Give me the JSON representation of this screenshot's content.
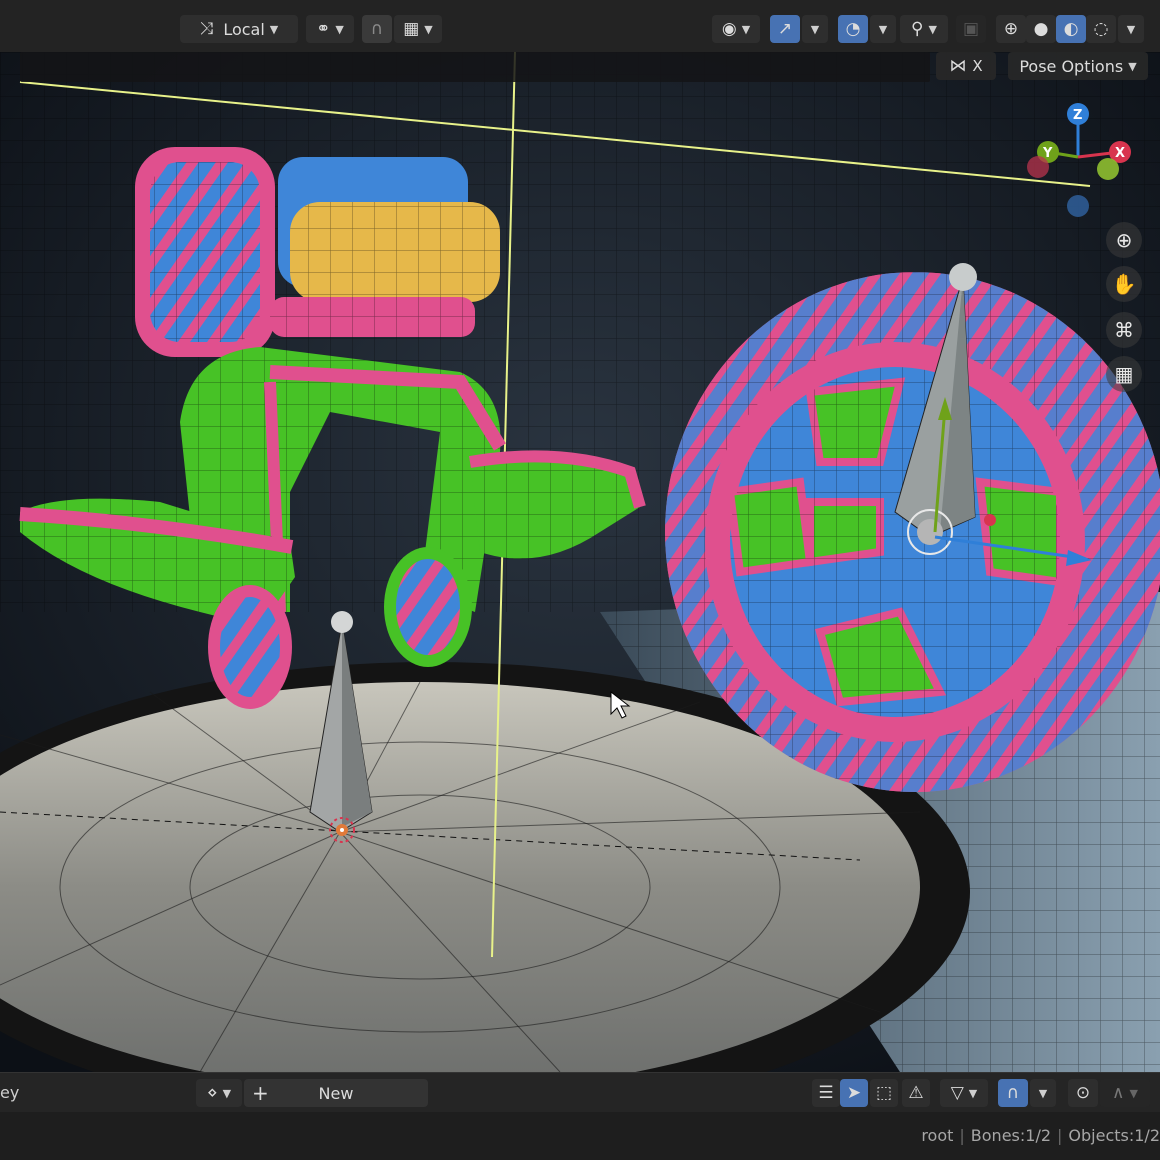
{
  "header": {
    "transform_orientation": "Local",
    "pose_options_label": "Pose Options",
    "x_mirror_label": "X"
  },
  "bottom": {
    "keying_label": "ey",
    "new_action_label": "New"
  },
  "status": {
    "active": "root",
    "bones": "Bones:1/2",
    "objects": "Objects:1/2"
  },
  "gizmo": {
    "x": "X",
    "y": "Y",
    "z": "Z"
  },
  "icons": {
    "orientation": "transform-orientation-icon",
    "pivot": "pivot-point-icon",
    "snap": "snap-magnet-icon",
    "proportional": "proportional-edit-icon",
    "visibility": "eye-icon",
    "gizmos": "gizmo-icon",
    "overlays": "overlay-icon",
    "xray": "xray-icon",
    "zoom": "zoom-icon",
    "pan": "hand-icon",
    "camera": "camera-icon",
    "ortho": "grid-icon"
  },
  "colors": {
    "accent": "#4772b3",
    "axis_x": "#d8344e",
    "axis_y": "#6fa21a",
    "axis_z": "#2f7fd8"
  }
}
